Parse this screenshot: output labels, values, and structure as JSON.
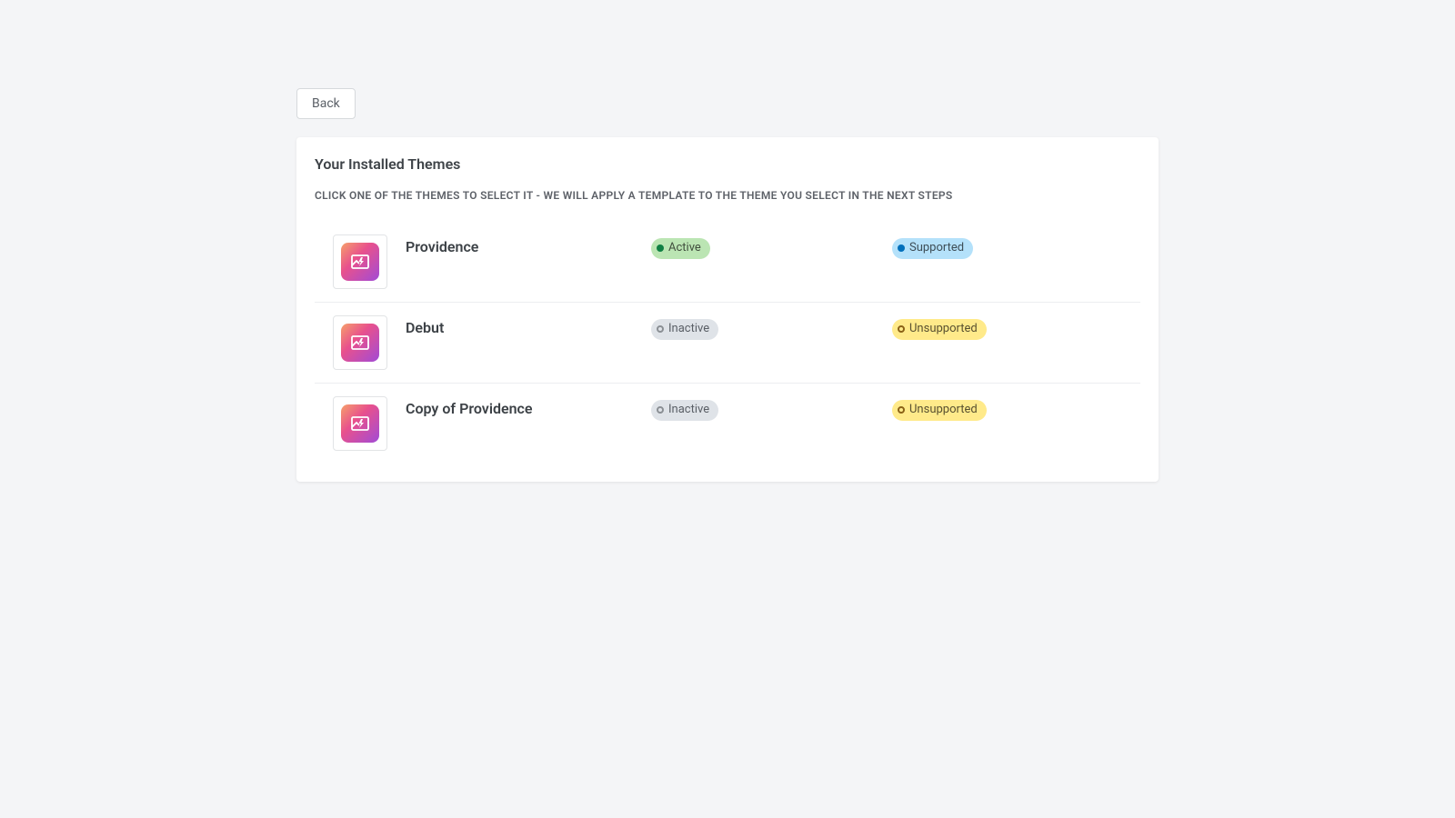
{
  "back": {
    "label": "Back"
  },
  "card": {
    "title": "Your Installed Themes",
    "subtitle": "CLICK ONE OF THE THEMES TO SELECT IT - WE WILL APPLY A TEMPLATE TO THE THEME YOU SELECT IN THE NEXT STEPS"
  },
  "badges": {
    "active": "Active",
    "inactive": "Inactive",
    "supported": "Supported",
    "unsupported": "Unsupported"
  },
  "themes": [
    {
      "name": "Providence",
      "status": "active",
      "support": "supported"
    },
    {
      "name": "Debut",
      "status": "inactive",
      "support": "unsupported"
    },
    {
      "name": "Copy of Providence",
      "status": "inactive",
      "support": "unsupported"
    }
  ]
}
